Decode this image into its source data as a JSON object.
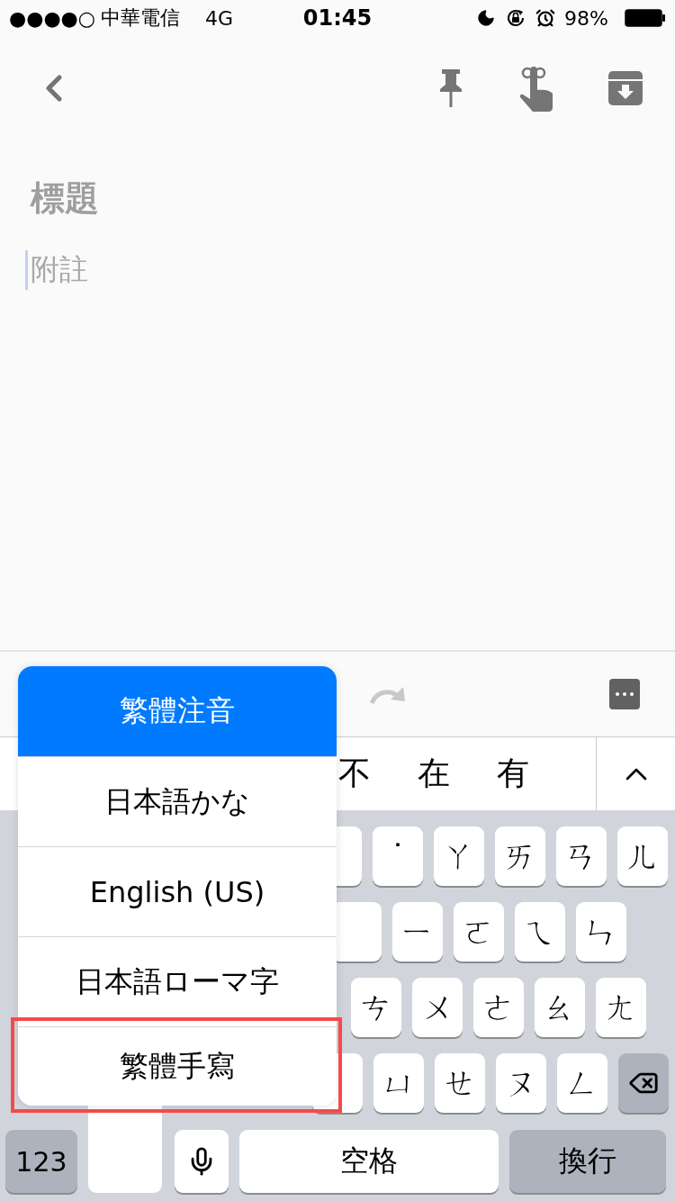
{
  "status_bar": {
    "signal": "●●●●○",
    "carrier": "中華電信",
    "network": "4G",
    "time": "01:45",
    "battery": "98%"
  },
  "note": {
    "title_placeholder": "標題",
    "body_placeholder": "附註"
  },
  "candidates": [
    "不",
    "在",
    "有"
  ],
  "keyboard": {
    "rows": [
      {
        "keys": [
          {
            "kind": "partial"
          },
          {
            "kind": "char",
            "label": "˙"
          },
          {
            "kind": "char",
            "label": "ㄚ"
          },
          {
            "kind": "char",
            "label": "ㄞ"
          },
          {
            "kind": "char",
            "label": "ㄢ"
          },
          {
            "kind": "char",
            "label": "ㄦ"
          }
        ]
      },
      {
        "keys": [
          {
            "kind": "partial"
          },
          {
            "kind": "char",
            "label": "ㄧ"
          },
          {
            "kind": "char",
            "label": "ㄛ"
          },
          {
            "kind": "char",
            "label": "ㄟ"
          },
          {
            "kind": "char",
            "label": "ㄣ"
          }
        ]
      },
      {
        "keys": [
          {
            "kind": "char",
            "label": "ㄘ"
          },
          {
            "kind": "char",
            "label": "ㄨ"
          },
          {
            "kind": "char",
            "label": "ㄜ"
          },
          {
            "kind": "char",
            "label": "ㄠ"
          },
          {
            "kind": "char",
            "label": "ㄤ"
          }
        ]
      },
      {
        "keys": [
          {
            "kind": "partial"
          },
          {
            "kind": "char",
            "label": "ㄩ"
          },
          {
            "kind": "char",
            "label": "ㄝ"
          },
          {
            "kind": "char",
            "label": "ㄡ"
          },
          {
            "kind": "char",
            "label": "ㄥ"
          },
          {
            "kind": "delete"
          }
        ]
      }
    ],
    "bottom": {
      "numbers": "123",
      "space": "空格",
      "return": "換行"
    }
  },
  "language_menu": [
    {
      "label": "繁體注音",
      "selected": true,
      "highlighted": false
    },
    {
      "label": "日本語かな",
      "selected": false,
      "highlighted": false
    },
    {
      "label": "English (US)",
      "selected": false,
      "highlighted": false
    },
    {
      "label": "日本語ローマ字",
      "selected": false,
      "highlighted": false
    },
    {
      "label": "繁體手寫",
      "selected": false,
      "highlighted": true
    }
  ]
}
